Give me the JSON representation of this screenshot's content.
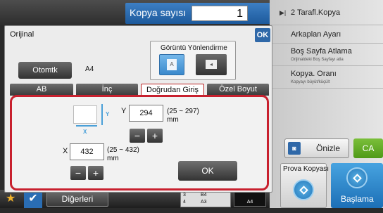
{
  "header": {
    "copies_label": "Kopya sayısı",
    "copies_value": "1"
  },
  "right_panel": {
    "items": [
      {
        "label": "2 Tarafl.Kopya",
        "sub": ""
      },
      {
        "label": "Arkaplan Ayarı",
        "sub": ""
      },
      {
        "label": "Boş Sayfa Atlama",
        "sub": "Orijinaldeki Boş Sayfayı atla"
      },
      {
        "label": "Kopya. Oranı",
        "sub": "Kopyayı büyüt/küçült"
      }
    ],
    "preview_label": "Önizle",
    "ca_label": "CA",
    "proof_label": "Prova Kopyası",
    "start_label": "Başlama"
  },
  "dialog": {
    "title": "Orijinal",
    "ok_label": "OK",
    "orientation_label": "Görüntü Yönlendirme",
    "orientation_icon": "A",
    "auto_button": "Otomtk",
    "auto_value": "A4",
    "tabs": [
      "AB",
      "İnç",
      "Doğrudan Giriş",
      "Özel Boyut"
    ],
    "active_tab": 2,
    "size": {
      "y_label": "Y",
      "y_value": "294",
      "y_range": "(25 ~ 297)",
      "x_label": "X",
      "x_value": "432",
      "x_range": "(25 ~ 432)",
      "unit": "mm",
      "arrow_x": "X",
      "arrow_y": "Y"
    },
    "ok_inner": "OK"
  },
  "bottom_bar": {
    "others_label": "Diğerleri",
    "tray_rows": [
      {
        "num": "3",
        "size": "B4"
      },
      {
        "num": "4",
        "size": "A3"
      }
    ],
    "tray_a4": "A4"
  },
  "colors": {
    "accent": "#2f68a8",
    "highlight_border": "#c8202e",
    "start_blue": "#1c6fb6",
    "ca_green": "#4f9a18"
  }
}
